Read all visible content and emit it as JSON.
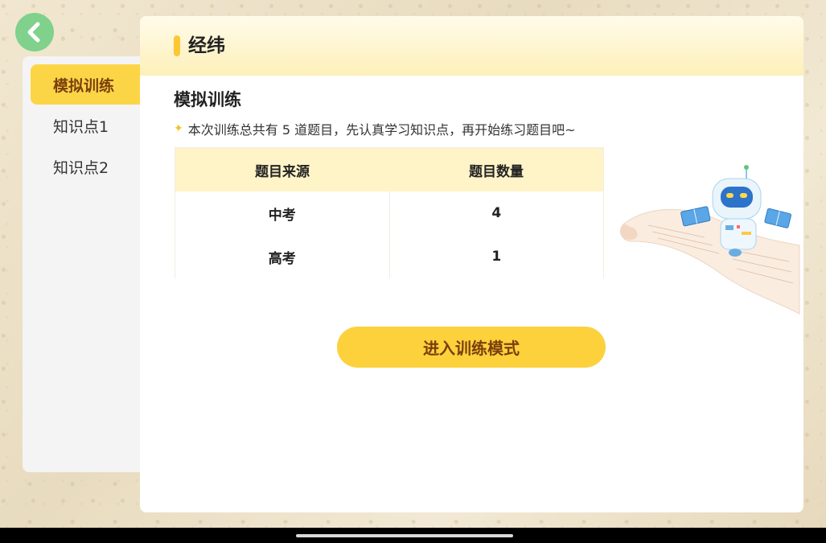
{
  "header": {
    "title": "经纬"
  },
  "sidebar": {
    "items": [
      {
        "label": "模拟训练",
        "active": true
      },
      {
        "label": "知识点1",
        "active": false
      },
      {
        "label": "知识点2",
        "active": false
      }
    ]
  },
  "main": {
    "section_title": "模拟训练",
    "notice": "本次训练总共有 5 道题目，先认真学习知识点，再开始练习题目吧~",
    "table": {
      "headers": [
        "题目来源",
        "题目数量"
      ],
      "rows": [
        [
          "中考",
          "4"
        ],
        [
          "高考",
          "1"
        ]
      ]
    },
    "start_button": "进入训练模式"
  },
  "colors": {
    "accent_yellow": "#fcd13c",
    "accent_brown": "#7b3f0c",
    "back_green": "#7fd18c",
    "table_header": "#fff3c8"
  },
  "icons": {
    "back": "chevron-left-icon",
    "notice": "star-icon",
    "illustration": "robot-illustration"
  }
}
